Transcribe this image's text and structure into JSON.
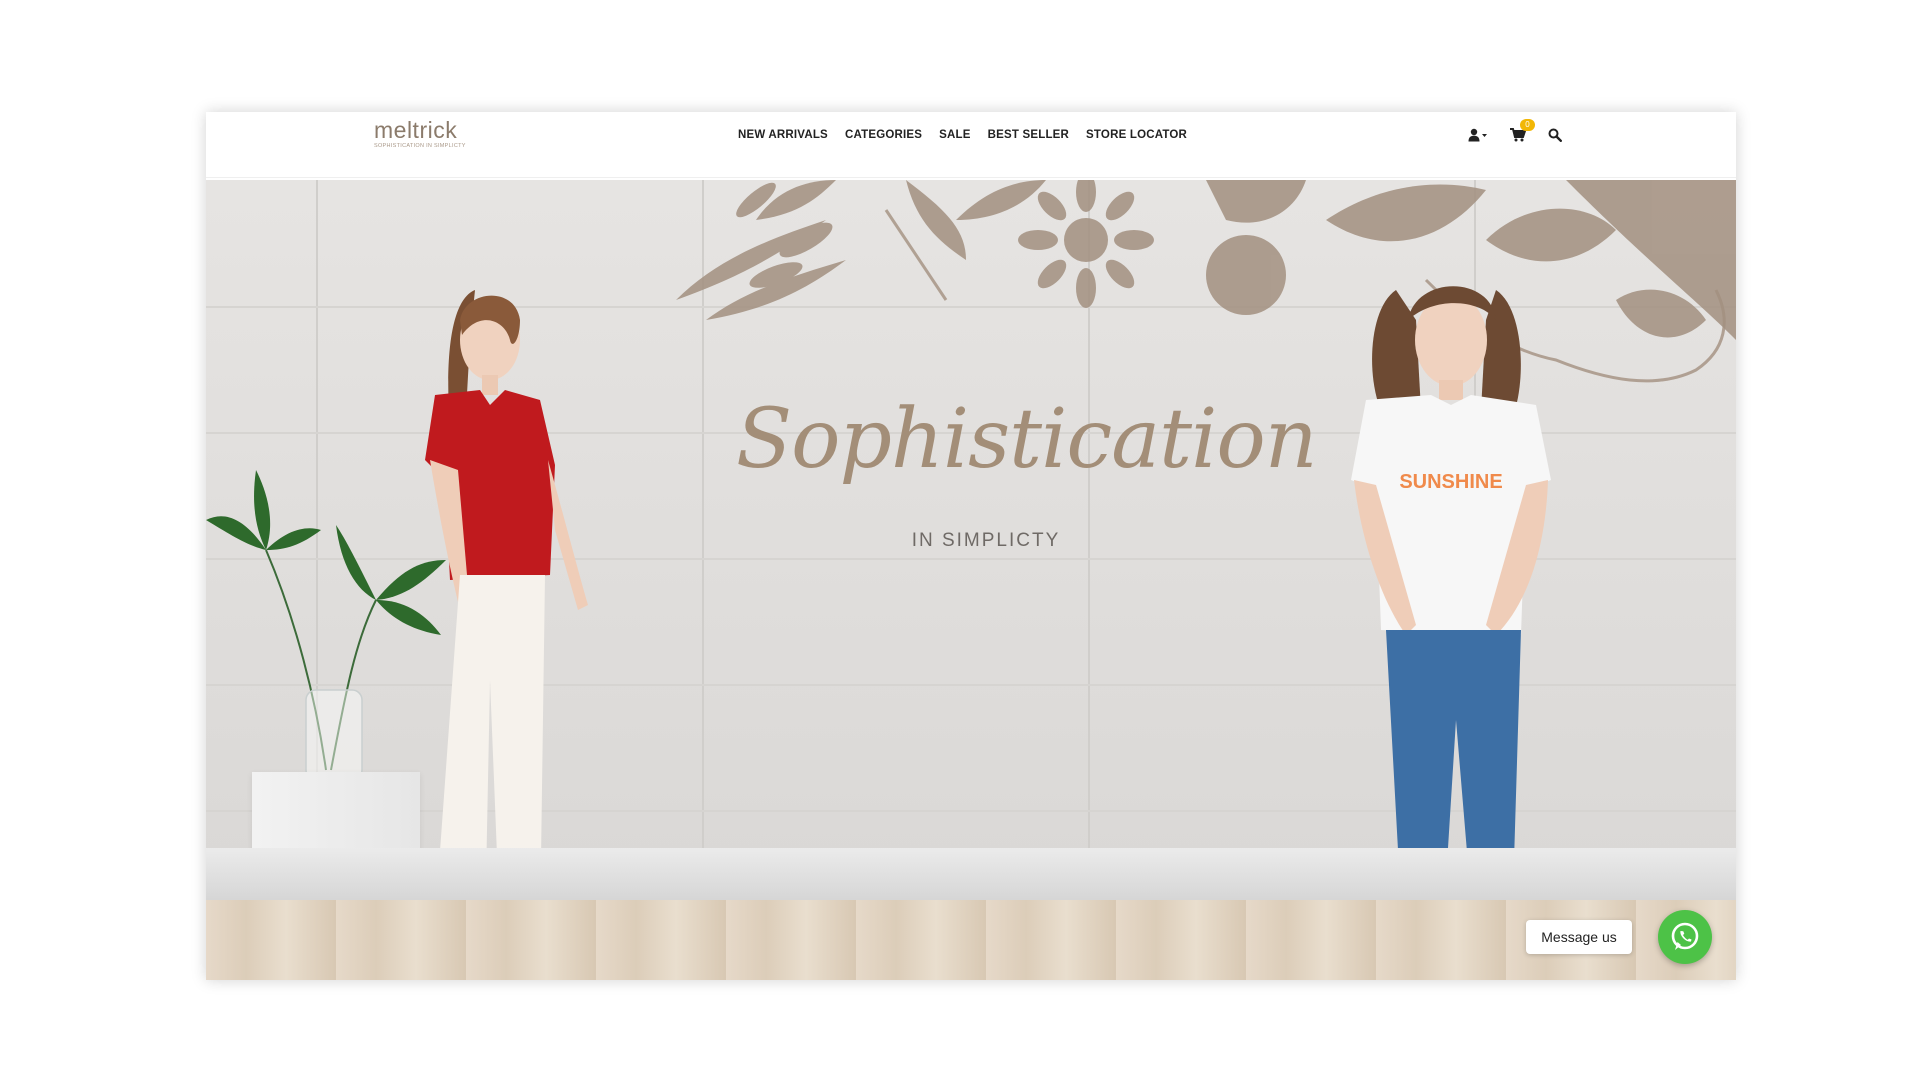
{
  "brand": {
    "name": "meltrick",
    "tagline": "SOPHISTICATION IN SIMPLICTY"
  },
  "nav": {
    "items": [
      {
        "label": "NEW ARRIVALS"
      },
      {
        "label": "CATEGORIES"
      },
      {
        "label": "SALE"
      },
      {
        "label": "BEST SELLER"
      },
      {
        "label": "STORE LOCATOR"
      }
    ]
  },
  "header_icons": {
    "account": "user-icon",
    "cart": "cart-icon",
    "cart_count": "0",
    "search": "search-icon"
  },
  "hero": {
    "title": "Sophistication",
    "subtitle": "IN SIMPLICTY",
    "print_text": "SUNSHINE"
  },
  "chat": {
    "label": "Message us",
    "icon": "whatsapp-icon"
  },
  "colors": {
    "accent_text": "#a38e78",
    "cart_badge": "#f2b705",
    "whatsapp": "#4dc247",
    "red_top": "#c01a1e"
  }
}
